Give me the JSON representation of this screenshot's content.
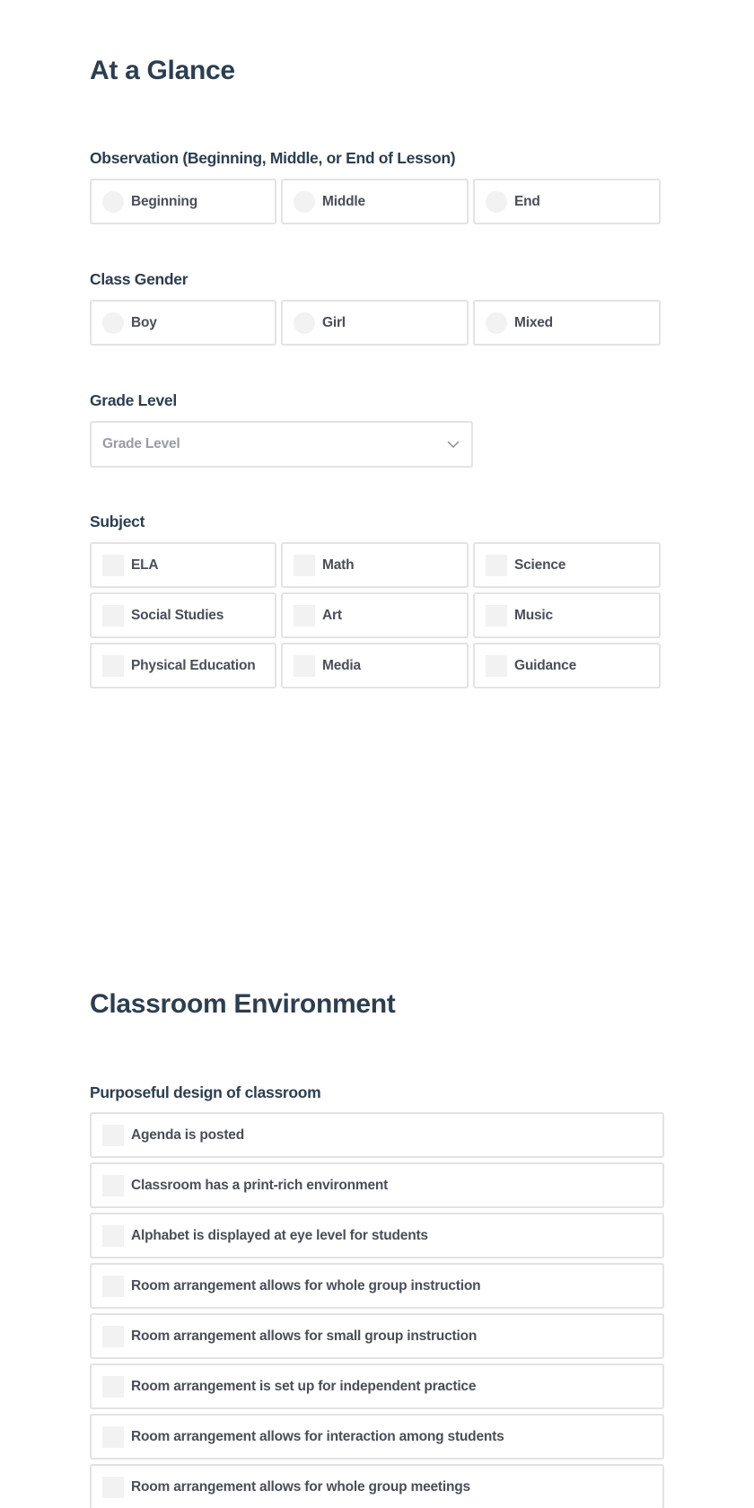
{
  "sections": {
    "at_a_glance": {
      "title": "At a Glance",
      "observation": {
        "label": "Observation (Beginning, Middle, or End of Lesson)",
        "options": [
          "Beginning",
          "Middle",
          "End"
        ]
      },
      "class_gender": {
        "label": "Class Gender",
        "options": [
          "Boy",
          "Girl",
          "Mixed"
        ]
      },
      "grade_level": {
        "label": "Grade Level",
        "placeholder": "Grade Level"
      },
      "subject": {
        "label": "Subject",
        "options": [
          "ELA",
          "Math",
          "Science",
          "Social Studies",
          "Art",
          "Music",
          "Physical Education",
          "Media",
          "Guidance"
        ]
      }
    },
    "classroom_environment": {
      "title": "Classroom Environment",
      "purposeful_design": {
        "label": "Purposeful design of classroom",
        "options": [
          "Agenda is posted",
          "Classroom has a print-rich environment",
          "Alphabet is displayed at eye level for students",
          "Room arrangement allows for whole group instruction",
          "Room arrangement allows for small group instruction",
          "Room arrangement is set up for independent practice",
          "Room arrangement allows for interaction among students",
          "Room arrangement allows for whole group meetings"
        ]
      }
    }
  }
}
